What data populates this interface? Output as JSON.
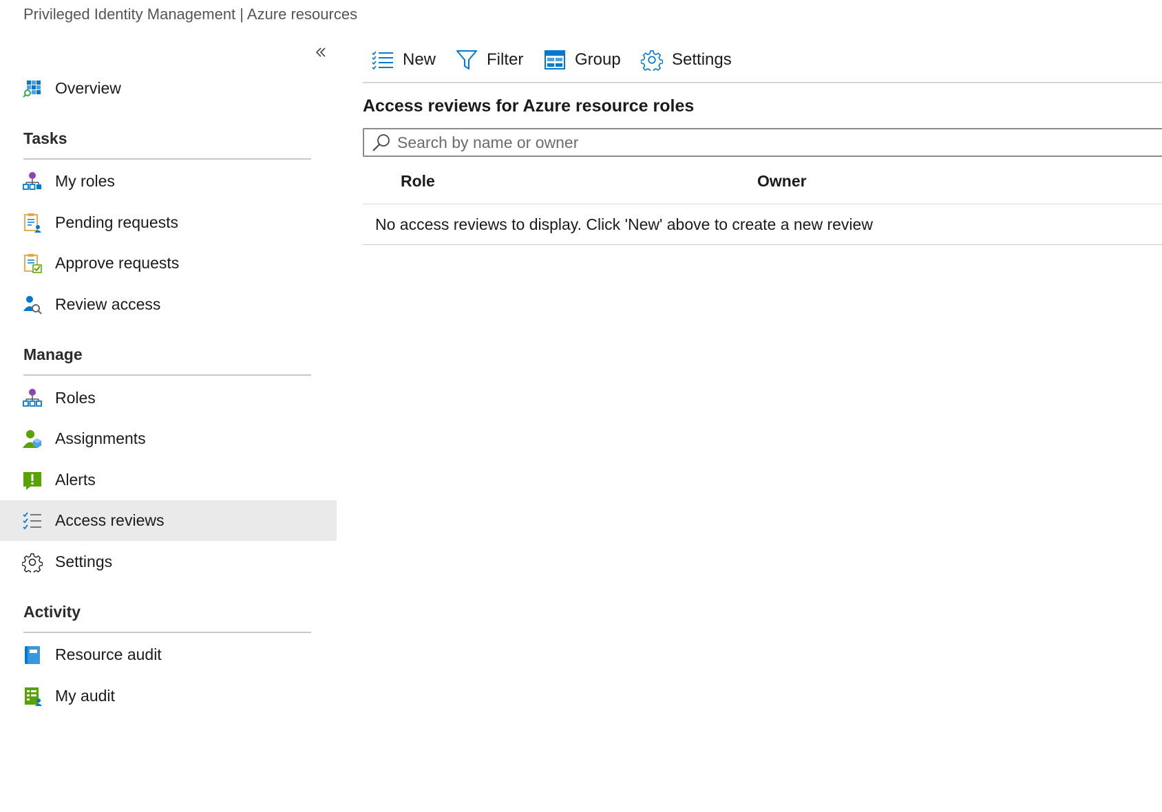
{
  "header": {
    "subtitle": "Privileged Identity Management | Azure resources"
  },
  "sidebar": {
    "overview": {
      "label": "Overview",
      "icon": "overview-grid-icon"
    },
    "sections": {
      "tasks": "Tasks",
      "manage": "Manage",
      "activity": "Activity"
    },
    "tasks_items": [
      {
        "label": "My roles",
        "icon": "my-roles-icon"
      },
      {
        "label": "Pending requests",
        "icon": "pending-requests-icon"
      },
      {
        "label": "Approve requests",
        "icon": "approve-requests-icon"
      },
      {
        "label": "Review access",
        "icon": "review-access-icon"
      }
    ],
    "manage_items": [
      {
        "label": "Roles",
        "icon": "roles-icon"
      },
      {
        "label": "Assignments",
        "icon": "assignments-icon"
      },
      {
        "label": "Alerts",
        "icon": "alerts-icon"
      },
      {
        "label": "Access reviews",
        "icon": "access-reviews-icon",
        "selected": true
      },
      {
        "label": "Settings",
        "icon": "gear-icon"
      }
    ],
    "activity_items": [
      {
        "label": "Resource audit",
        "icon": "resource-audit-icon"
      },
      {
        "label": "My audit",
        "icon": "my-audit-icon"
      }
    ]
  },
  "toolbar": {
    "new_label": "New",
    "filter_label": "Filter",
    "group_label": "Group",
    "settings_label": "Settings"
  },
  "main": {
    "heading": "Access reviews for Azure resource roles",
    "search_placeholder": "Search by name or owner",
    "search_value": "",
    "columns": [
      "Role",
      "Owner"
    ],
    "empty_message": "No access reviews to display. Click 'New' above to create a new review"
  },
  "colors": {
    "accent": "#0078d4",
    "selected_bg": "#ebeaea",
    "alert_green": "#57a300",
    "role_purple": "#8e44ad"
  }
}
